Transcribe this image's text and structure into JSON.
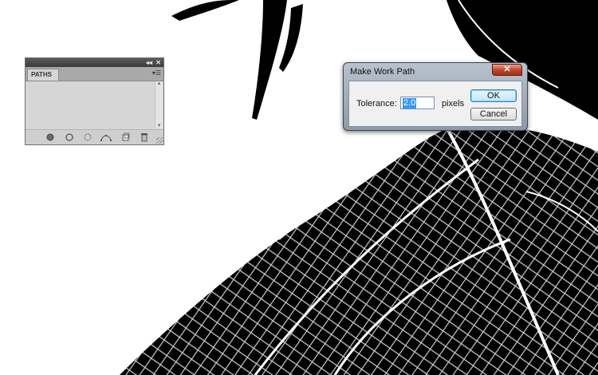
{
  "paths_panel": {
    "tab_label": "PATHS",
    "collapse_glyph": "◂◂",
    "close_glyph": "✕",
    "menu_glyph": "▾☰",
    "footer_icons": [
      "fill-path-icon",
      "stroke-path-icon",
      "load-as-selection-icon",
      "make-work-path-icon",
      "new-path-icon",
      "delete-path-icon"
    ]
  },
  "dialog": {
    "title": "Make Work Path",
    "close_glyph": "✕",
    "tolerance_label": "Tolerance:",
    "tolerance_value": "2.0",
    "tolerance_units": "pixels",
    "ok_label": "OK",
    "cancel_label": "Cancel",
    "close_color": "#c7462c",
    "ok_focus_color": "#3c7fb1"
  },
  "canvas": {
    "background_color": "#ffffff",
    "artwork_color": "#000000"
  }
}
